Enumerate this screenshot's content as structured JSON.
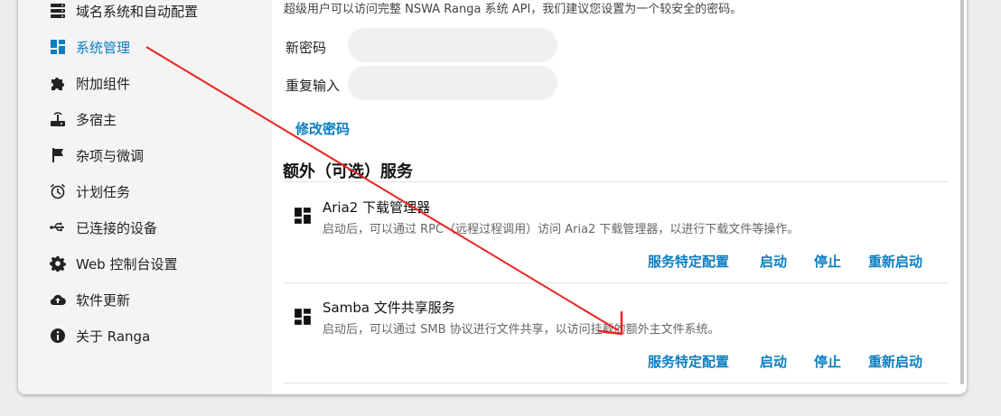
{
  "sidebar": {
    "items": [
      {
        "label": "域名系统和自动配置",
        "icon": "server-icon"
      },
      {
        "label": "系统管理",
        "icon": "dashboard-icon",
        "active": true
      },
      {
        "label": "附加组件",
        "icon": "puzzle-icon"
      },
      {
        "label": "多宿主",
        "icon": "router-icon"
      },
      {
        "label": "杂项与微调",
        "icon": "flag-icon"
      },
      {
        "label": "计划任务",
        "icon": "alarm-clock-icon"
      },
      {
        "label": "已连接的设备",
        "icon": "usb-icon"
      },
      {
        "label": "Web 控制台设置",
        "icon": "gear-icon"
      },
      {
        "label": "软件更新",
        "icon": "cloud-upload-icon"
      },
      {
        "label": "关于 Ranga",
        "icon": "info-icon"
      }
    ]
  },
  "password": {
    "intro": "超级用户可以访问完整 NSWA Ranga 系统 API，我们建议您设置为一个较安全的密码。",
    "new_label": "新密码",
    "repeat_label": "重复输入",
    "change_button": "修改密码"
  },
  "services": {
    "title": "额外（可选）服务",
    "items": [
      {
        "name": "Aria2 下载管理器",
        "desc": "启动后，可以通过 RPC（远程过程调用）访问 Aria2 下载管理器，以进行下载文件等操作。",
        "config": "服务特定配置",
        "start": "启动",
        "stop": "停止",
        "restart": "重新启动"
      },
      {
        "name": "Samba 文件共享服务",
        "desc": "启动后，可以通过 SMB 协议进行文件共享，以访问挂载的额外主文件系统。",
        "config": "服务特定配置",
        "start": "启动",
        "stop": "停止",
        "restart": "重新启动"
      }
    ]
  },
  "colors": {
    "accent": "#0a7ec2",
    "annotation_arrow": "#e8231f"
  }
}
